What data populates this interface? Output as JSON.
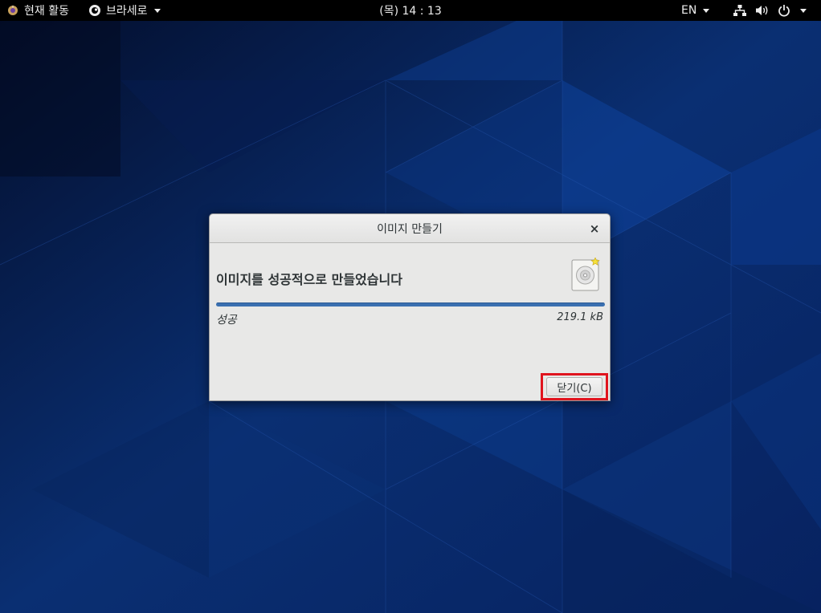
{
  "topbar": {
    "activities_label": "현재 활동",
    "app_label": "브라세로",
    "clock": "(목) 14 : 13",
    "language": "EN",
    "icons": [
      "network-icon",
      "volume-icon",
      "power-icon"
    ]
  },
  "dialog": {
    "title": "이미지 만들기",
    "close_glyph": "×",
    "message": "이미지를 성공적으로 만들었습니다",
    "progress": 1.0,
    "status": "성공",
    "size": "219.1 kB",
    "close_button_label": "닫기(C)"
  },
  "colors": {
    "desktop_bg": "#061a44",
    "accent_blue": "#3a6fb0",
    "highlight_red": "#e0141e"
  }
}
